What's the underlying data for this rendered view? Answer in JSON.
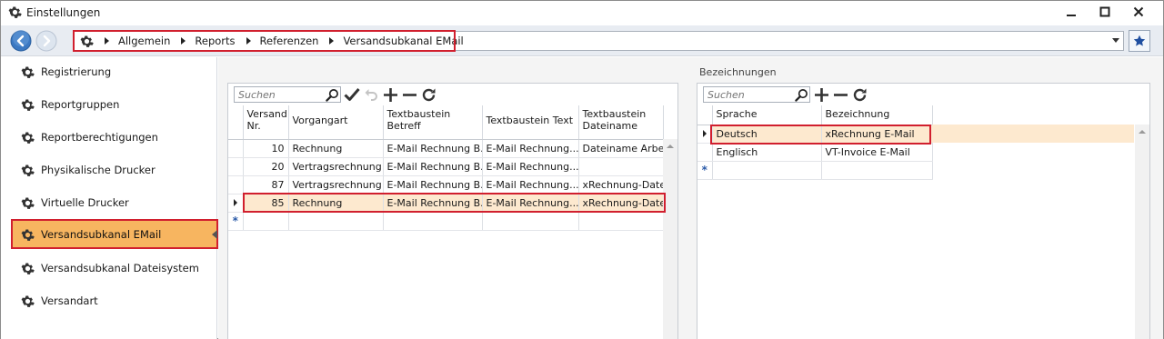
{
  "window": {
    "title": "Einstellungen",
    "icon": "gear-icon",
    "controls": [
      "minimize",
      "maximize",
      "close"
    ]
  },
  "breadcrumb": {
    "home_icon": "gear-icon",
    "items": [
      "Allgemein",
      "Reports",
      "Referenzen",
      "Versandsubkanal EMail"
    ]
  },
  "sidebar": {
    "items": [
      {
        "label": "Registrierung",
        "icon": "gear-icon"
      },
      {
        "label": "Reportgruppen",
        "icon": "gear-icon"
      },
      {
        "label": "Reportberechtigungen",
        "icon": "gear-icon"
      },
      {
        "label": "Physikalische Drucker",
        "icon": "gear-icon"
      },
      {
        "label": "Virtuelle Drucker",
        "icon": "gear-icon"
      },
      {
        "label": "Versandsubkanal EMail",
        "icon": "gear-icon",
        "active": true
      },
      {
        "label": "Versandsubkanal Dateisystem",
        "icon": "gear-icon"
      },
      {
        "label": "Versandart",
        "icon": "gear-icon"
      }
    ]
  },
  "left_grid": {
    "search_placeholder": "Suchen",
    "toolbar_icons": [
      "search-icon",
      "check-icon",
      "undo-icon",
      "add-icon",
      "remove-icon",
      "refresh-icon"
    ],
    "columns": [
      "Versand Nr.",
      "Vorgangart",
      "Textbaustein Betreff",
      "Textbaustein Text",
      "Textbaustein Dateiname"
    ],
    "rows": [
      [
        "10",
        "Rechnung",
        "E-Mail Rechnung B...",
        "E-Mail Rechnung...",
        "Dateiname Arbeits"
      ],
      [
        "20",
        "Vertragsrechnung",
        "E-Mail Rechnung B...",
        "E-Mail Rechnung...",
        ""
      ],
      [
        "87",
        "Vertragsrechnung",
        "E-Mail Rechnung B...",
        "E-Mail Rechnung...",
        "xRechnung-Datein"
      ],
      [
        "85",
        "Rechnung",
        "E-Mail Rechnung B...",
        "E-Mail Rechnung...",
        "xRechnung-Datein"
      ]
    ],
    "selected_row": 3
  },
  "right_grid": {
    "section_label": "Bezeichnungen",
    "search_placeholder": "Suchen",
    "toolbar_icons": [
      "search-icon",
      "add-icon",
      "remove-icon",
      "refresh-icon"
    ],
    "columns": [
      "Sprache",
      "Bezeichnung"
    ],
    "rows": [
      [
        "Deutsch",
        "xRechnung E-Mail"
      ],
      [
        "Englisch",
        "VT-Invoice E-Mail"
      ]
    ],
    "selected_row": 0
  },
  "colors": {
    "accent_active": "#f7b560",
    "selected_row": "#fde9cf",
    "highlight_border": "#d11f2e"
  }
}
